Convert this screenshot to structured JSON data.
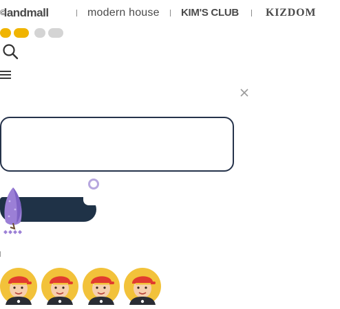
{
  "brands": [
    {
      "name": "landmall",
      "mark": "©"
    },
    {
      "name": "modern house"
    },
    {
      "name": "KIM'S CLUB"
    },
    {
      "name": "KIZDOM"
    }
  ],
  "toggles": [
    {
      "state": "active",
      "color": "#f0b400"
    },
    {
      "state": "active",
      "color": "#f0b400"
    },
    {
      "state": "inactive",
      "color": "#d4d4d4"
    },
    {
      "state": "inactive",
      "color": "#d4d4d4"
    }
  ],
  "icons": {
    "search": "search-icon",
    "menu": "menu-icon",
    "close": "close-icon",
    "tree": "tree-illustration",
    "avatar": "avatar-character"
  },
  "search": {
    "value": "",
    "placeholder": ""
  },
  "colors": {
    "navy": "#1f3247",
    "border": "#25324a",
    "yellow": "#f0b400",
    "purple": "#9b7fd6"
  },
  "avatars": [
    {
      "name": "avatar"
    },
    {
      "name": "avatar"
    },
    {
      "name": "avatar"
    },
    {
      "name": "avatar"
    }
  ]
}
